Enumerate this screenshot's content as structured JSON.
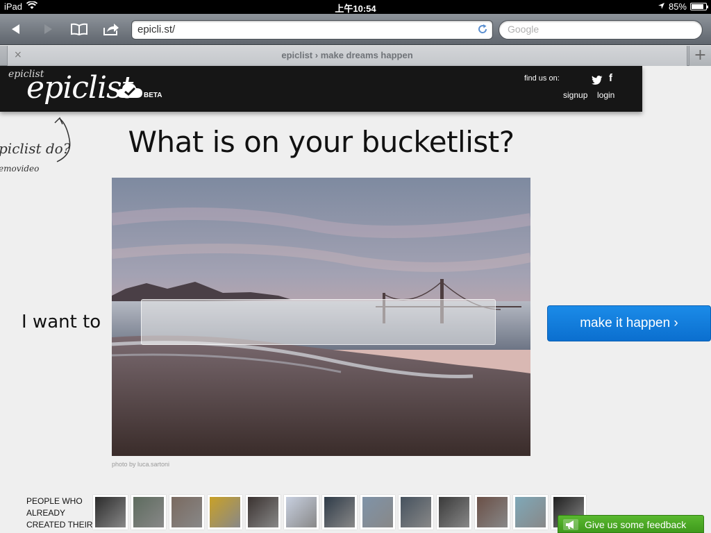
{
  "status_bar": {
    "device": "iPad",
    "time": "上午10:54",
    "battery": "85%",
    "battery_level": 0.85
  },
  "browser": {
    "url": "epicli.st/",
    "search_placeholder": "Google",
    "tab_title": "epiclist › make dreams happen",
    "close_tab": "×",
    "new_tab": "+"
  },
  "site": {
    "logo_small": "epiclist",
    "logo": "epiclist",
    "beta": "BETA",
    "find_us": "find us on:",
    "facebook": "f",
    "signup": "signup",
    "login": "login"
  },
  "annotation": {
    "line1": "piclist do?",
    "line2": "emovideo"
  },
  "main": {
    "headline": "What is on your bucketlist?",
    "i_want_to": "I want to",
    "input_value": "",
    "cta": "make it happen ›",
    "photo_credit": "photo by luca.sartoni"
  },
  "people": {
    "label_lines": [
      "PEOPLE WHO",
      "ALREADY",
      "CREATED THEIR"
    ],
    "avatar_colors": [
      "#2b2b2b",
      "#5d6b5e",
      "#7a6a60",
      "#c9a127",
      "#3a3230",
      "#c8d0e0",
      "#2f3b48",
      "#7f93a8",
      "#46525e",
      "#3a3a3a",
      "#6a4f46",
      "#7fa8b8",
      "#1f1f1f"
    ]
  },
  "feedback": {
    "label": "Give us some feedback"
  },
  "colors": {
    "cta_blue": "#0b6fcf",
    "feedback_green": "#3f9a1c",
    "header_black": "#161616"
  }
}
